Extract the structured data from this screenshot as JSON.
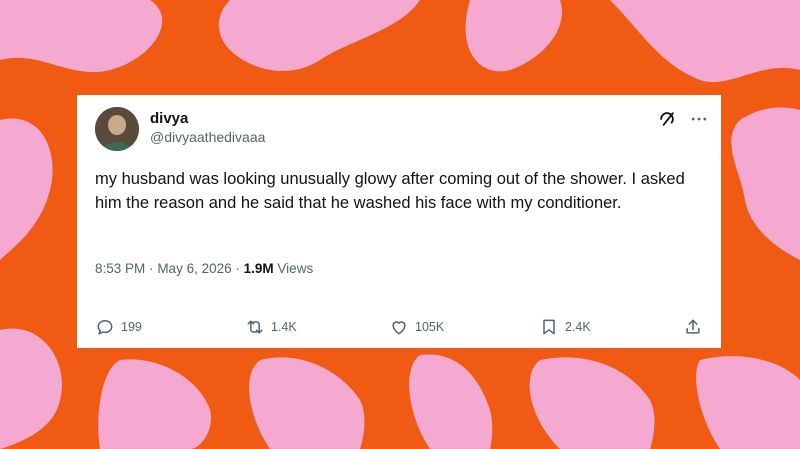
{
  "background": {
    "colors": {
      "orange": "#f05a12",
      "pink": "#f5a9d0"
    }
  },
  "tweet": {
    "author_name": "divya",
    "author_handle": "@divyaathedivaaa",
    "text": "my husband was looking unusually glowy after coming out of the shower. I asked him the reason and he said that he washed his face with my conditioner.",
    "time": "8:53 PM",
    "separator_1": "·",
    "date": "May 6, 2026",
    "separator_2": "·",
    "views_count": "1.9M",
    "views_label": "Views",
    "header_icons": [
      "grok-icon",
      "more-icon"
    ]
  },
  "actions": {
    "replies": {
      "icon": "reply-icon",
      "count": "199"
    },
    "reposts": {
      "icon": "repost-icon",
      "count": "1.4K"
    },
    "likes": {
      "icon": "like-icon",
      "count": "105K"
    },
    "bookmarks": {
      "icon": "bookmark-icon",
      "count": "2.4K"
    },
    "share": {
      "icon": "share-icon"
    }
  },
  "colors": {
    "text_primary": "#0f1419",
    "text_secondary": "#536471",
    "card_bg": "#ffffff"
  }
}
